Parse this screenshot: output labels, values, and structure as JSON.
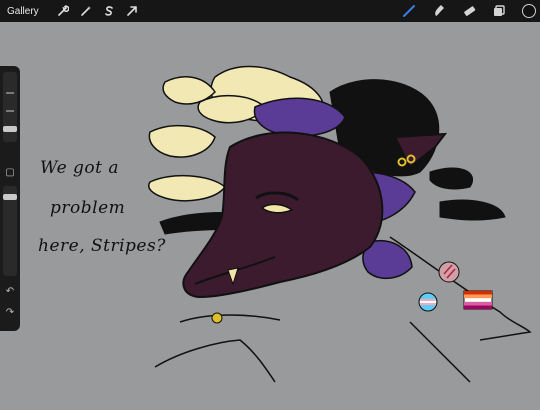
{
  "app": {
    "gallery_label": "Gallery"
  },
  "toolbar": {
    "left_icons": [
      "wrench-icon",
      "magic-wand-icon",
      "selection-s-icon",
      "transform-arrow-icon"
    ],
    "right_icons": [
      "brush-icon",
      "smudge-icon",
      "eraser-icon",
      "layers-icon"
    ],
    "active_tool": "brush",
    "active_color": "#111111",
    "accent": "#3a7ee0"
  },
  "sidebar": {
    "brush_size_level": 0.68,
    "opacity_level": 0.0
  },
  "canvas": {
    "background": "#999a9b",
    "handwritten_lines": [
      "We got a",
      "problem",
      "here, Stripes?"
    ]
  }
}
